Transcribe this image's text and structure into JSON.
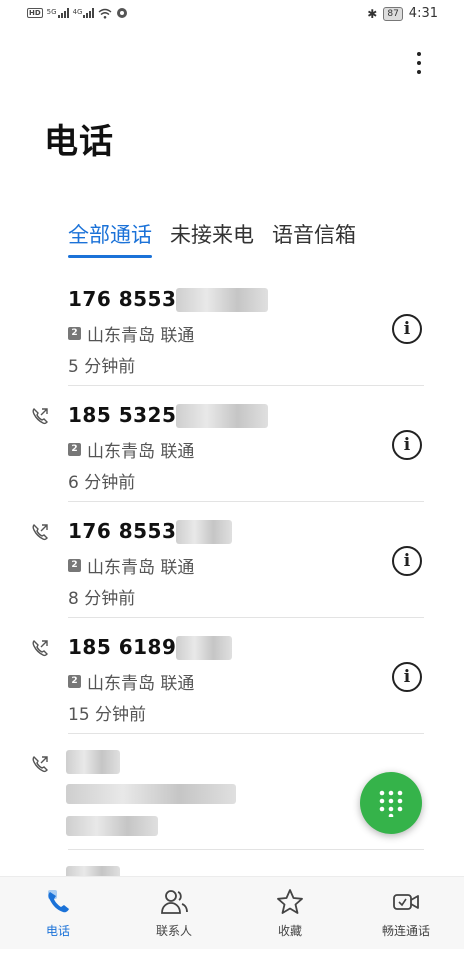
{
  "status_bar": {
    "left_icons": [
      "hd-icon",
      "signal-5g-icon",
      "signal-4g-icon",
      "wifi-icon",
      "app-icon"
    ],
    "net1": "5G",
    "net2": "4G",
    "battery": "87",
    "time": "4:31"
  },
  "page": {
    "title": "电话"
  },
  "tabs": [
    {
      "label": "全部通话",
      "active": true
    },
    {
      "label": "未接来电",
      "active": false
    },
    {
      "label": "语音信箱",
      "active": false
    }
  ],
  "calls": [
    {
      "number": "176 8553",
      "sim": "2",
      "location": "山东青岛 联通",
      "time": "5 分钟前",
      "outgoing": false
    },
    {
      "number": "185 5325",
      "sim": "2",
      "location": "山东青岛 联通",
      "time": "6 分钟前",
      "outgoing": true
    },
    {
      "number": "176 8553",
      "sim": "2",
      "location": "山东青岛 联通",
      "time": "8 分钟前",
      "outgoing": true
    },
    {
      "number": "185 6189",
      "sim": "2",
      "location": "山东青岛 联通",
      "time": "15 分钟前",
      "outgoing": true
    }
  ],
  "info_glyph": "i",
  "bottom_nav": [
    {
      "label": "电话",
      "icon": "phone-icon",
      "active": true
    },
    {
      "label": "联系人",
      "icon": "contacts-icon",
      "active": false
    },
    {
      "label": "收藏",
      "icon": "star-icon",
      "active": false
    },
    {
      "label": "畅连通话",
      "icon": "video-call-icon",
      "active": false
    }
  ],
  "colors": {
    "accent": "#1b72d8",
    "fab": "#35b34a"
  }
}
